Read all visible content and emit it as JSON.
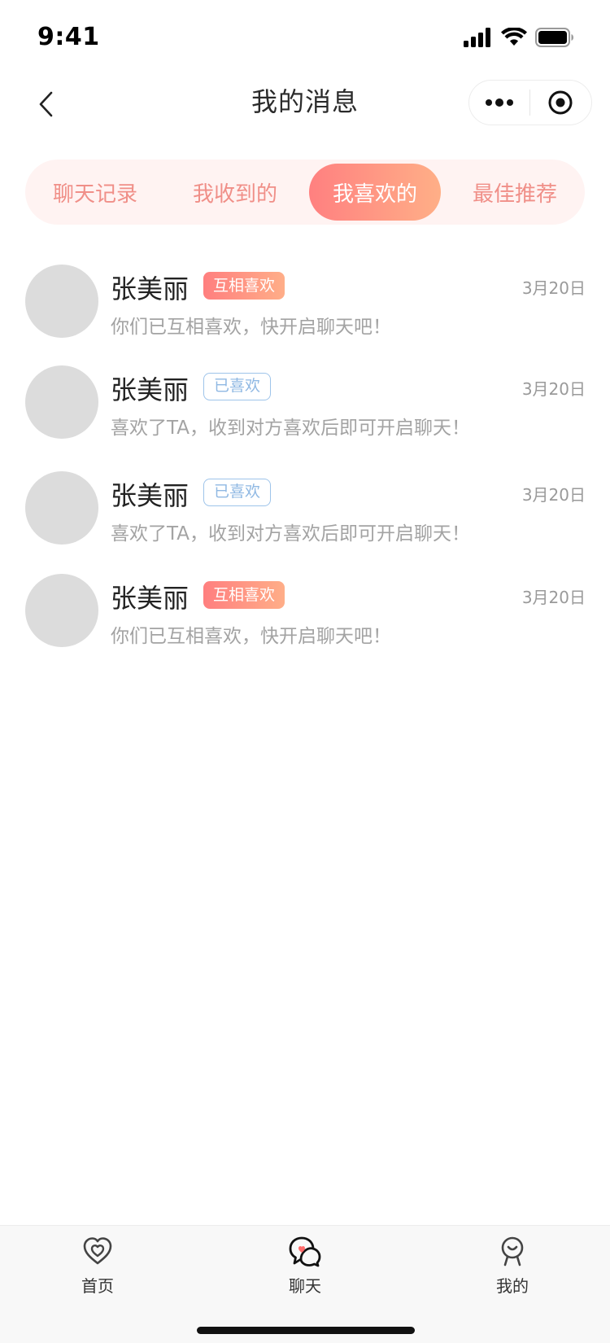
{
  "status_bar": {
    "time": "9:41"
  },
  "nav": {
    "title": "我的消息"
  },
  "tabs": [
    {
      "label": "聊天记录",
      "active": false
    },
    {
      "label": "我收到的",
      "active": false
    },
    {
      "label": "我喜欢的",
      "active": true
    },
    {
      "label": "最佳推荐",
      "active": false
    }
  ],
  "messages": [
    {
      "name": "张美丽",
      "badge": "互相喜欢",
      "badge_type": "mutual",
      "date": "3月20日",
      "preview": "你们已互相喜欢，快开启聊天吧！"
    },
    {
      "name": "张美丽",
      "badge": "已喜欢",
      "badge_type": "liked",
      "date": "3月20日",
      "preview": "喜欢了TA，收到对方喜欢后即可开启聊天！"
    },
    {
      "name": "张美丽",
      "badge": "已喜欢",
      "badge_type": "liked",
      "date": "3月20日",
      "preview": "喜欢了TA，收到对方喜欢后即可开启聊天！"
    },
    {
      "name": "张美丽",
      "badge": "互相喜欢",
      "badge_type": "mutual",
      "date": "3月20日",
      "preview": "你们已互相喜欢，快开启聊天吧！"
    }
  ],
  "tab_bar": [
    {
      "label": "首页",
      "icon": "heart-home-icon"
    },
    {
      "label": "聊天",
      "icon": "chat-bubble-icon"
    },
    {
      "label": "我的",
      "icon": "profile-icon"
    }
  ],
  "colors": {
    "accent_start": "#ff8080",
    "accent_end": "#ffaf87",
    "tab_text": "#f08f88",
    "liked_badge": "#8fb8e3"
  }
}
